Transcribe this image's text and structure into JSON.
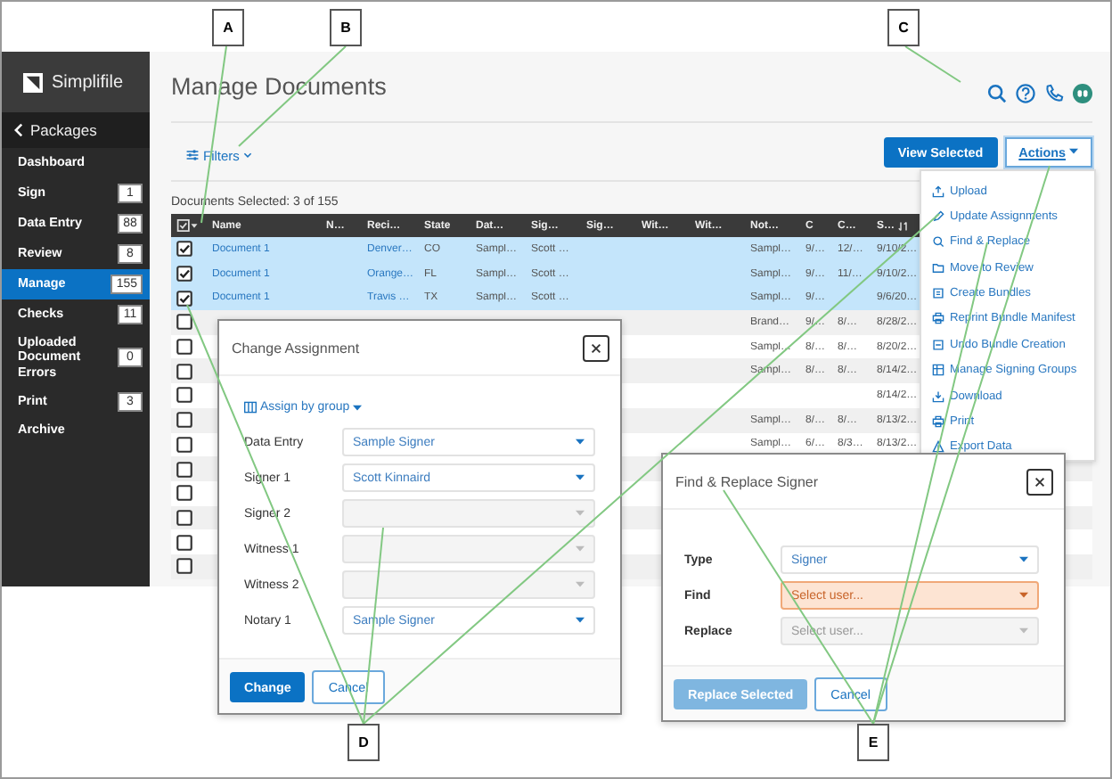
{
  "sidebar": {
    "logo": "Simplifile",
    "back": "Packages",
    "items": [
      {
        "label": "Dashboard",
        "selected": false
      },
      {
        "label": "Sign",
        "count": "1",
        "selected": false
      },
      {
        "label": "Data Entry",
        "count": "88",
        "selected": false
      },
      {
        "label": "Review",
        "count": "8",
        "selected": false
      },
      {
        "label": "Manage",
        "count": "155",
        "selected": true
      },
      {
        "label": "Checks",
        "count": "11",
        "selected": false
      },
      {
        "label": "Uploaded Document Errors",
        "count": "0",
        "selected": false
      },
      {
        "label": "Print",
        "count": "3",
        "selected": false
      },
      {
        "label": "Archive",
        "selected": false
      }
    ]
  },
  "header": {
    "title": "Manage Documents"
  },
  "toolbar": {
    "filters": "Filters",
    "view_selected": "View Selected",
    "actions": "Actions"
  },
  "selection_summary": "Documents Selected: 3 of 155",
  "table": {
    "columns": [
      {
        "label": "Name",
        "link": true
      },
      {
        "label": "N…"
      },
      {
        "label": "Reci…",
        "link": true
      },
      {
        "label": "State",
        "link": false
      },
      {
        "label": "Dat…",
        "link": false
      },
      {
        "label": "Sig…",
        "link": false
      },
      {
        "label": "Sig…"
      },
      {
        "label": "Wit…"
      },
      {
        "label": "Wit…"
      },
      {
        "label": "Not…",
        "link": false
      },
      {
        "label": "C",
        "link": false
      },
      {
        "label": "C…",
        "link": false
      },
      {
        "label": "S…",
        "link": false
      }
    ],
    "rows": [
      {
        "checked": true,
        "cells": [
          "Document 1",
          null,
          "Denver…",
          "CO",
          "Sampl…",
          "Scott …",
          null,
          null,
          null,
          "Sampl…",
          "9/…",
          "12/…",
          "9/10/2…"
        ]
      },
      {
        "checked": true,
        "cells": [
          "Document 1",
          null,
          "Orange…",
          "FL",
          "Sampl…",
          "Scott …",
          null,
          null,
          null,
          "Sampl…",
          "9/…",
          "11/…",
          "9/10/2…"
        ]
      },
      {
        "checked": true,
        "cells": [
          "Document 1",
          null,
          "Travis …",
          "TX",
          "Sampl…",
          "Scott …",
          null,
          null,
          null,
          "Sampl…",
          "9/…",
          null,
          "9/6/20…"
        ]
      },
      {
        "checked": false,
        "cells": [
          null,
          null,
          null,
          null,
          null,
          null,
          null,
          null,
          null,
          "Brand…",
          "9/…",
          "8/…",
          "8/28/2…"
        ]
      },
      {
        "checked": false,
        "cells": [
          null,
          null,
          null,
          null,
          null,
          null,
          null,
          null,
          null,
          "Sampl…",
          "8/…",
          "8/…",
          "8/20/2…"
        ]
      },
      {
        "checked": false,
        "cells": [
          null,
          null,
          null,
          null,
          null,
          null,
          null,
          null,
          null,
          "Sampl…",
          "8/…",
          "8/…",
          "8/14/2…"
        ]
      },
      {
        "checked": false,
        "cells": [
          null,
          null,
          null,
          null,
          null,
          null,
          null,
          null,
          null,
          null,
          null,
          null,
          "8/14/2…"
        ]
      },
      {
        "checked": false,
        "cells": [
          null,
          null,
          null,
          null,
          null,
          null,
          null,
          null,
          null,
          "Sampl…",
          "8/…",
          "8/…",
          "8/13/2…"
        ]
      },
      {
        "checked": false,
        "cells": [
          null,
          null,
          null,
          null,
          null,
          null,
          null,
          null,
          null,
          "Sampl…",
          "6/…",
          "8/3…",
          "8/13/2…"
        ]
      },
      {
        "checked": false
      },
      {
        "checked": false
      },
      {
        "checked": false
      },
      {
        "checked": false
      },
      {
        "checked": false
      }
    ]
  },
  "actions_menu": {
    "items": [
      "Upload",
      "Update Assignments",
      "Find & Replace",
      "Move to Review",
      "Create Bundles",
      "Reprint Bundle Manifest",
      "Undo Bundle Creation",
      "Manage Signing Groups",
      "Download",
      "Print",
      "Export Data"
    ]
  },
  "change_assignment": {
    "title": "Change Assignment",
    "group_link": "Assign by group",
    "fields": [
      {
        "label": "Data Entry",
        "value": "Sample Signer",
        "disabled": false
      },
      {
        "label": "Signer 1",
        "value": "Scott Kinnaird",
        "disabled": false
      },
      {
        "label": "Signer 2",
        "disabled": true
      },
      {
        "label": "Witness 1",
        "disabled": true
      },
      {
        "label": "Witness 2",
        "disabled": true
      },
      {
        "label": "Notary 1",
        "value": "Sample Signer",
        "disabled": false
      }
    ],
    "primary": "Change",
    "cancel": "Cancel"
  },
  "find_replace": {
    "title": "Find & Replace Signer",
    "fields": [
      {
        "label": "Type",
        "value": "Signer",
        "disabled": false,
        "error": false
      },
      {
        "label": "Find",
        "placeholder": "Select user...",
        "disabled": false,
        "error": true
      },
      {
        "label": "Replace",
        "placeholder": "Select user...",
        "disabled": true,
        "error": false
      }
    ],
    "primary": "Replace Selected",
    "primary_disabled": true,
    "cancel": "Cancel"
  },
  "callouts": [
    {
      "label": "A"
    },
    {
      "label": "B"
    },
    {
      "label": "C"
    },
    {
      "label": "D"
    },
    {
      "label": "E"
    }
  ]
}
